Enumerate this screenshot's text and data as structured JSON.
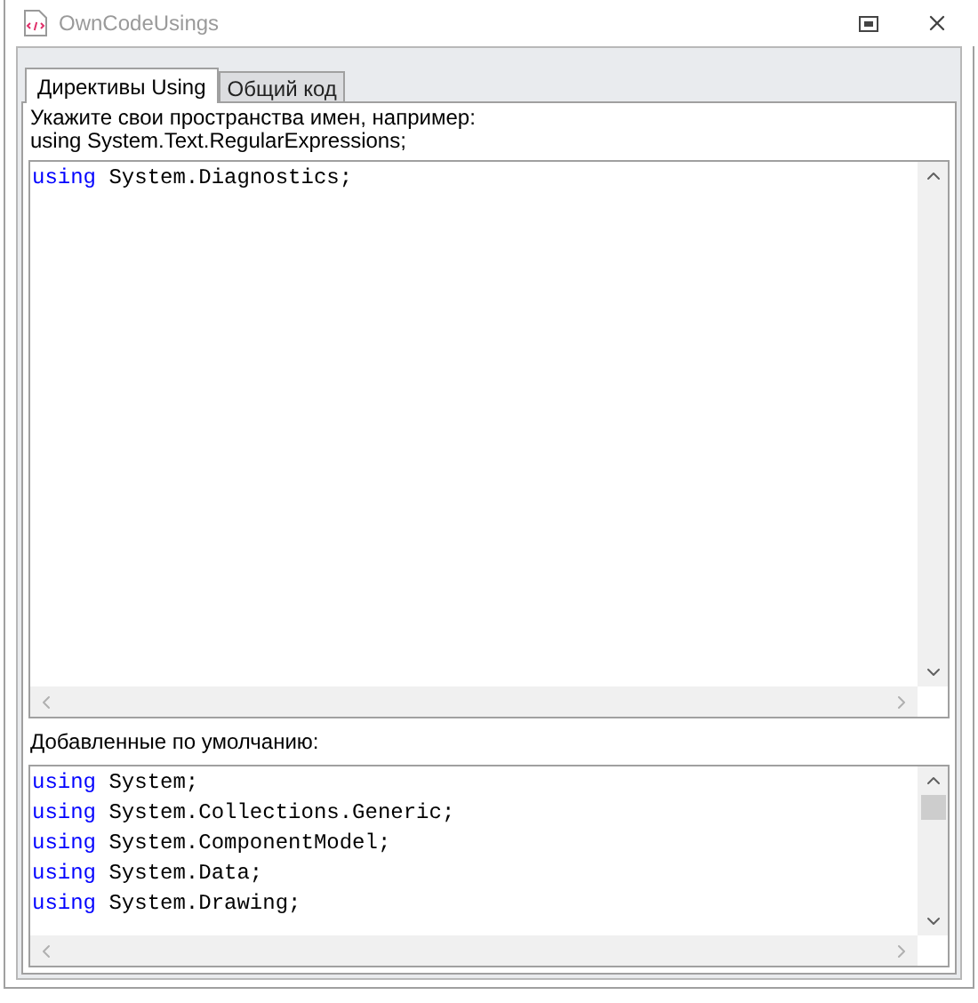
{
  "window": {
    "title": "OwnCodeUsings"
  },
  "tabs": [
    {
      "label": "Директивы Using",
      "selected": true
    },
    {
      "label": "Общий код",
      "selected": false
    }
  ],
  "hint": [
    "Укажите свои пространства имен, например:",
    "using System.Text.RegularExpressions;"
  ],
  "custom_editor": {
    "lines": [
      {
        "keyword": "using",
        "text": "System.Diagnostics;"
      }
    ]
  },
  "defaults_label": "Добавленные по умолчанию:",
  "defaults_editor": {
    "lines": [
      {
        "keyword": "using",
        "text": "System;"
      },
      {
        "keyword": "using",
        "text": "System.Collections.Generic;"
      },
      {
        "keyword": "using",
        "text": "System.ComponentModel;"
      },
      {
        "keyword": "using",
        "text": "System.Data;"
      },
      {
        "keyword": "using",
        "text": "System.Drawing;"
      }
    ]
  }
}
